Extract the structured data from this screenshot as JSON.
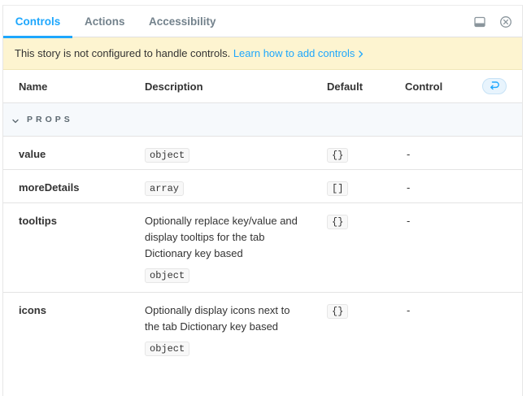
{
  "tabs": {
    "controls": "Controls",
    "actions": "Actions",
    "accessibility": "Accessibility"
  },
  "banner": {
    "text": "This story is not configured to handle controls.",
    "link": "Learn how to add controls"
  },
  "table": {
    "headers": {
      "name": "Name",
      "description": "Description",
      "default": "Default",
      "control": "Control"
    },
    "section": "PROPS",
    "rows": [
      {
        "name": "value",
        "description": "",
        "type": "object",
        "default": "{}",
        "control": "-"
      },
      {
        "name": "moreDetails",
        "description": "",
        "type": "array",
        "default": "[]",
        "control": "-"
      },
      {
        "name": "tooltips",
        "description": "Optionally replace key/value and display tooltips for the tab Dictionary key based",
        "type": "object",
        "default": "{}",
        "control": "-"
      },
      {
        "name": "icons",
        "description": "Optionally display icons next to the tab Dictionary key based",
        "type": "object",
        "default": "{}",
        "control": "-"
      }
    ]
  },
  "colors": {
    "accent": "#1ea7fd",
    "banner_bg": "#fdf4d0",
    "section_bg": "#f6f9fc"
  },
  "icons": {
    "dock": "dock-bottom-icon",
    "close": "close-icon",
    "undo": "undo-icon",
    "section_toggle": "chevron-down-icon",
    "link": "chevron-right-icon"
  }
}
